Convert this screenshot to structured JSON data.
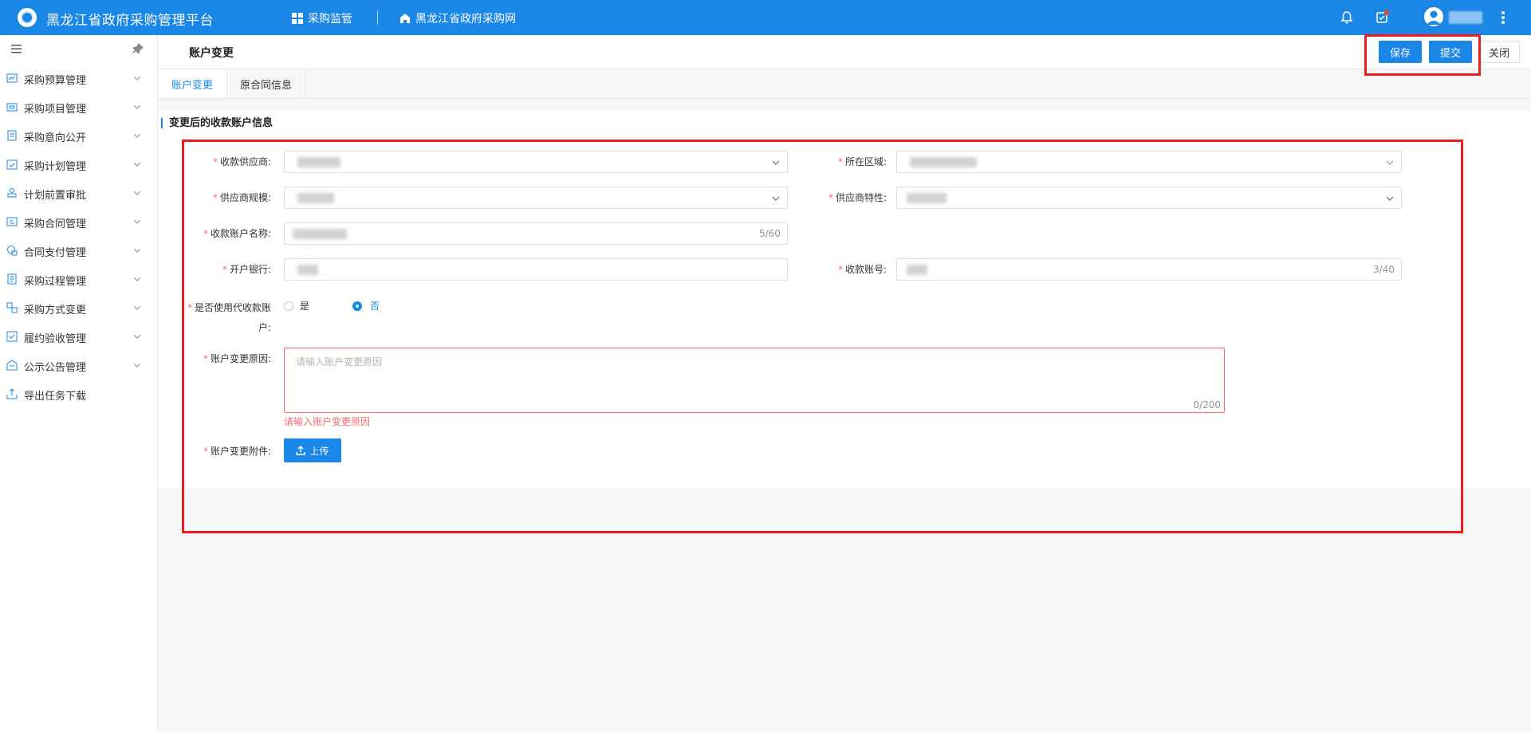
{
  "topbar": {
    "title": "黑龙江省政府采购管理平台",
    "nav": [
      {
        "label": "采购监管",
        "icon": "grid-icon"
      },
      {
        "label": "黑龙江省政府采购网",
        "icon": "home-icon"
      }
    ],
    "icons": [
      "bell-icon",
      "task-check-icon",
      "user-avatar-icon",
      "more-vertical-icon"
    ]
  },
  "sidebar": {
    "items": [
      {
        "label": "采购预算管理",
        "icon": "chart-icon"
      },
      {
        "label": "采购项目管理",
        "icon": "folder-icon"
      },
      {
        "label": "采购意向公开",
        "icon": "document-icon"
      },
      {
        "label": "采购计划管理",
        "icon": "calendar-check-icon"
      },
      {
        "label": "计划前置审批",
        "icon": "stamp-icon"
      },
      {
        "label": "采购合同管理",
        "icon": "contract-icon"
      },
      {
        "label": "合同支付管理",
        "icon": "payment-icon"
      },
      {
        "label": "采购过程管理",
        "icon": "process-icon"
      },
      {
        "label": "采购方式变更",
        "icon": "swap-icon"
      },
      {
        "label": "履约验收管理",
        "icon": "checklist-icon"
      },
      {
        "label": "公示公告管理",
        "icon": "announcement-icon"
      },
      {
        "label": "导出任务下载",
        "icon": "export-icon"
      }
    ]
  },
  "header": {
    "title": "账户变更",
    "save_label": "保存",
    "submit_label": "提交",
    "close_label": "关闭"
  },
  "tabs": [
    {
      "label": "账户变更",
      "active": true
    },
    {
      "label": "原合同信息",
      "active": false
    }
  ],
  "form": {
    "section_title": "变更后的收款账户信息",
    "fields": {
      "supplier": {
        "label": "收款供应商:"
      },
      "region": {
        "label": "所在区域:"
      },
      "scale": {
        "label": "供应商规模:"
      },
      "nature": {
        "label": "供应商特性:"
      },
      "account_name": {
        "label": "收款账户名称:",
        "count": "5/60"
      },
      "bank": {
        "label": "开户银行:"
      },
      "account_no": {
        "label": "收款账号:",
        "count": "3/40"
      },
      "agent_account": {
        "label_line1": "是否使用代收款账",
        "label_line2": "户:",
        "options": [
          "是",
          "否"
        ],
        "selected": "否"
      },
      "reason": {
        "label": "账户变更原因:",
        "placeholder": "请输入账户变更原因",
        "count": "0/200",
        "error": "请输入账户变更原因"
      },
      "attachment": {
        "label": "账户变更附件:",
        "upload_label": "上传"
      }
    }
  },
  "colors": {
    "primary": "#1a86e6",
    "required": "#f56c6c",
    "highlight": "#ee1c1c"
  }
}
